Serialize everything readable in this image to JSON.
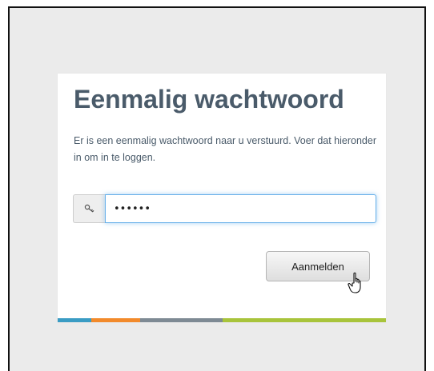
{
  "login": {
    "title": "Eenmalig wachtwoord",
    "instructions": "Er is een eenmalig wachtwoord naar u verstuurd. Voer dat hieronder in om in te loggen.",
    "password_value": "123456",
    "password_icon": "key-icon",
    "submit_label": "Aanmelden"
  },
  "pointer_icon": "hand-pointer-icon",
  "accent_colors": {
    "title": "#4a5b6a",
    "focus_border": "#66afe9",
    "stripe": [
      "#3a9cc4",
      "#f28a2b",
      "#7e8a94",
      "#a8c43b"
    ]
  }
}
